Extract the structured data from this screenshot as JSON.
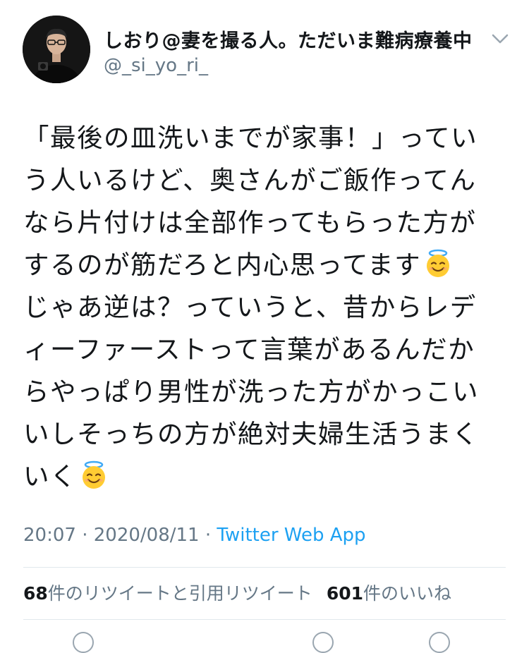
{
  "author": {
    "display_name": "しおり@妻を撮る人。ただいま難病療養中",
    "handle": "@_si_yo_ri_"
  },
  "tweet": {
    "lines": [
      "「最後の皿洗いまでが家事！」ってい",
      "う人いるけど、奥さんがご飯作ってん",
      "なら片付けは全部作ってもらった方が",
      "するのが筋だろと内心思ってます",
      "じゃあ逆は？っていうと、昔からレデ",
      "ィーファーストって言葉があるんだか",
      "らやっぱり男性が洗った方がかっこい",
      "いしそっちの方が絶対夫婦生活うまく",
      "いく"
    ],
    "emoji_name": "smiling-face-with-halo"
  },
  "meta": {
    "time": "20:07",
    "separator": "·",
    "date": "2020/08/11",
    "app": "Twitter Web App"
  },
  "stats": {
    "retweets_count": "68",
    "retweets_label": "件のリツイートと引用リツイート",
    "likes_count": "601",
    "likes_label": "件のいいね"
  },
  "colors": {
    "text": "#14171a",
    "secondary": "#657786",
    "accent": "#1da1f2",
    "divider": "#e1e8ed"
  }
}
